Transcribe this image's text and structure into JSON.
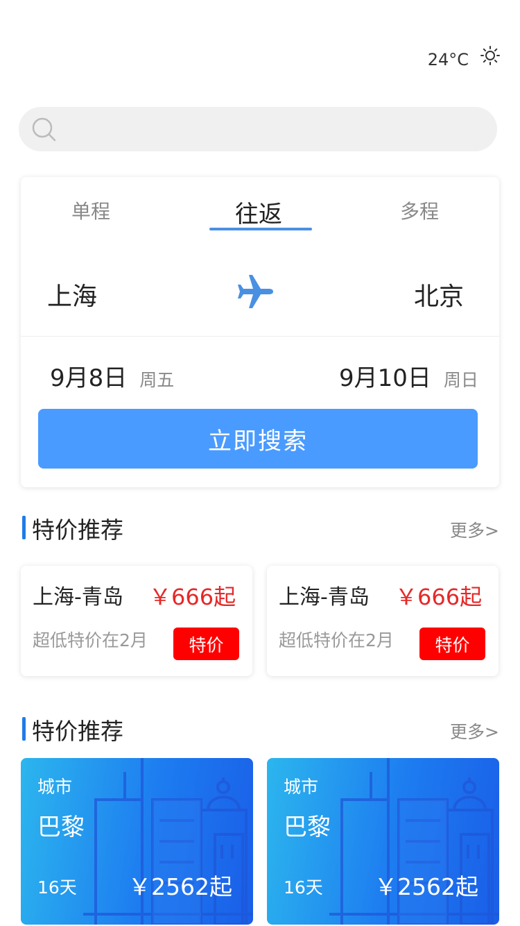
{
  "weather": {
    "temperature": "24°C",
    "icon": "sun-icon"
  },
  "search": {
    "placeholder": "",
    "icon": "search-icon"
  },
  "booking": {
    "tabs": [
      {
        "label": "单程",
        "active": false
      },
      {
        "label": "往返",
        "active": true
      },
      {
        "label": "多程",
        "active": false
      }
    ],
    "from_city": "上海",
    "to_city": "北京",
    "depart_date": "9月8日",
    "depart_weekday": "周五",
    "return_date": "9月10日",
    "return_weekday": "周日",
    "search_button": "立即搜索",
    "accent_color": "#4a9bff"
  },
  "deals_section": {
    "title": "特价推荐",
    "more": "更多>",
    "items": [
      {
        "route": "上海-青岛",
        "price": "￥666起",
        "desc": "超低特价在2月",
        "badge": "特价"
      },
      {
        "route": "上海-青岛",
        "price": "￥666起",
        "desc": "超低特价在2月",
        "badge": "特价"
      }
    ]
  },
  "city_section": {
    "title": "特价推荐",
    "more": "更多>",
    "items": [
      {
        "label": "城市",
        "city": "巴黎",
        "days": "16天",
        "price": "￥2562起"
      },
      {
        "label": "城市",
        "city": "巴黎",
        "days": "16天",
        "price": "￥2562起"
      }
    ]
  },
  "colors": {
    "price_red": "#e52828",
    "badge_red": "#ff0000",
    "section_bar": "#1e7ce8"
  }
}
